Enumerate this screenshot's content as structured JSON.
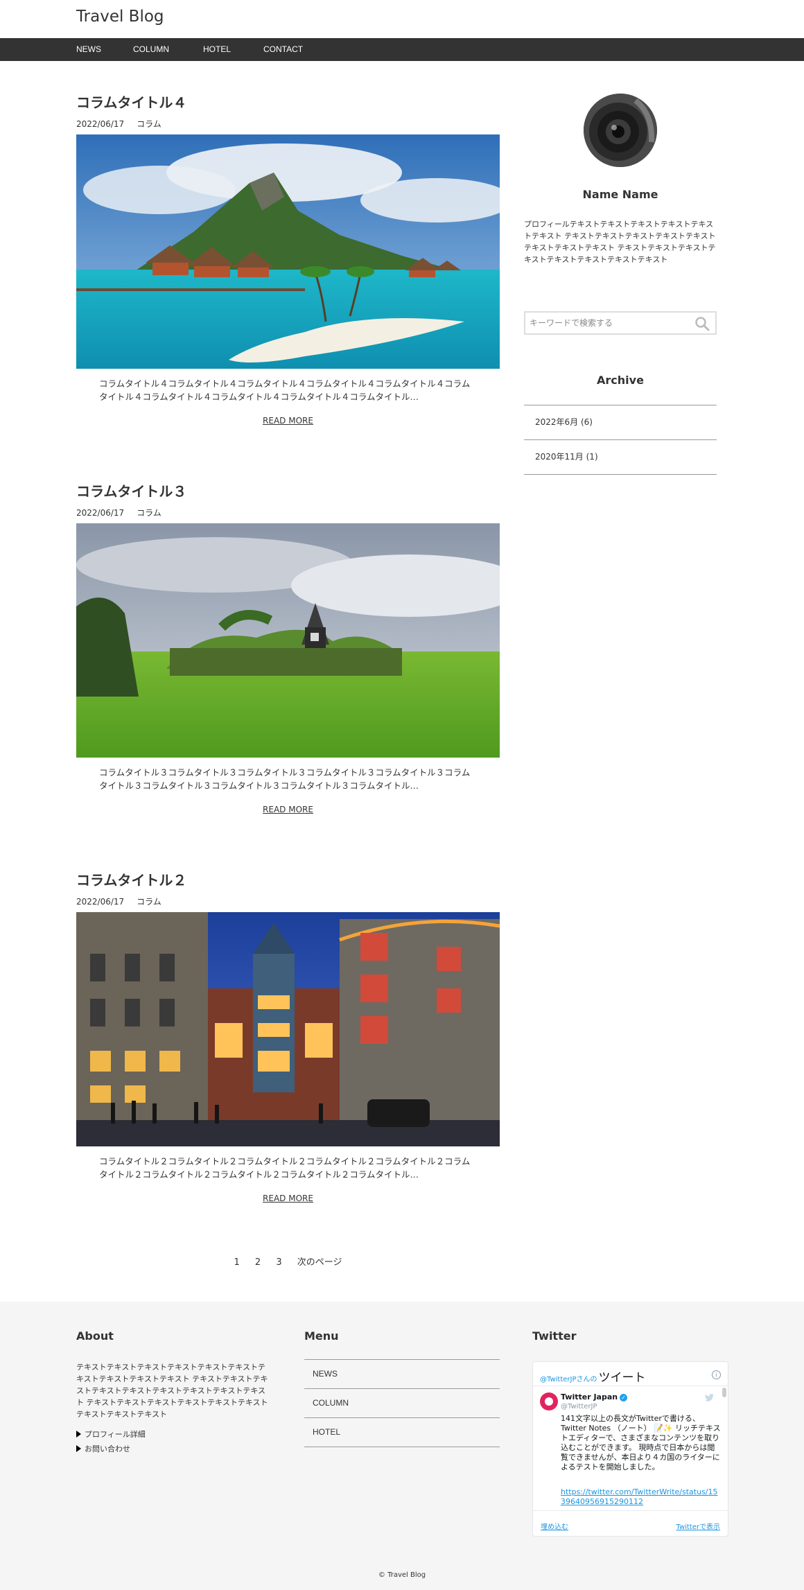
{
  "header": {
    "site_title": "Travel Blog"
  },
  "nav": {
    "items": [
      {
        "label": "NEWS"
      },
      {
        "label": "COLUMN"
      },
      {
        "label": "HOTEL"
      },
      {
        "label": "CONTACT"
      }
    ]
  },
  "posts": [
    {
      "title": "コラムタイトル４",
      "date": "2022/06/17",
      "category": "コラム",
      "excerpt": "コラムタイトル４コラムタイトル４コラムタイトル４コラムタイトル４コラムタイトル４コラムタイトル４コラムタイトル４コラムタイトル４コラムタイトル４コラムタイトル…",
      "read_more": "READ MORE"
    },
    {
      "title": "コラムタイトル３",
      "date": "2022/06/17",
      "category": "コラム",
      "excerpt": "コラムタイトル３コラムタイトル３コラムタイトル３コラムタイトル３コラムタイトル３コラムタイトル３コラムタイトル３コラムタイトル３コラムタイトル３コラムタイトル…",
      "read_more": "READ MORE"
    },
    {
      "title": "コラムタイトル２",
      "date": "2022/06/17",
      "category": "コラム",
      "excerpt": "コラムタイトル２コラムタイトル２コラムタイトル２コラムタイトル２コラムタイトル２コラムタイトル２コラムタイトル２コラムタイトル２コラムタイトル２コラムタイトル…",
      "read_more": "READ MORE"
    }
  ],
  "pagination": {
    "pages": [
      "1",
      "2",
      "3"
    ],
    "next": "次のページ"
  },
  "sidebar": {
    "profile_name": "Name Name",
    "profile_text": "プロフィールテキストテキストテキストテキストテキストテキスト テキストテキストテキストテキストテキストテキストテキストテキスト テキストテキストテキストテキストテキストテキストテキストテキスト",
    "search_placeholder": "キーワードで検索する",
    "archive_title": "Archive",
    "archives": [
      {
        "label": "2022年6月 (6)"
      },
      {
        "label": "2020年11月 (1)"
      }
    ]
  },
  "footer": {
    "about_heading": "About",
    "about_text": "テキストテキストテキストテキストテキストテキストテキストテキストテキストテキスト テキストテキストテキストテキストテキストテキストテキストテキストテキスト テキストテキストテキストテキストテキストテキストテキストテキストテキスト",
    "about_links": [
      {
        "label": "プロフィール詳細"
      },
      {
        "label": "お問い合わせ"
      }
    ],
    "menu_heading": "Menu",
    "menu_items": [
      {
        "label": "NEWS"
      },
      {
        "label": "COLUMN"
      },
      {
        "label": "HOTEL"
      }
    ],
    "twitter_heading": "Twitter",
    "copyright": "© Travel Blog"
  },
  "twitter_embed": {
    "header_prefix": "@TwitterJPさんの",
    "header_main": "ツイート",
    "info_icon": "i",
    "account_name": "Twitter Japan",
    "account_handle": "@TwitterJP",
    "tweet_text": "141文字以上の長文がTwitterで書ける、Twitter Notes （ノート） 📝✨ リッチテキストエディターで、さまざまなコンテンツを取り込むことができます。 現時点で日本からは閲覧できませんが、本日より４カ国のライターによるテストを開始しました。",
    "tweet_link": "https://twitter.com/TwitterWrite/status/1539640956915290112",
    "embed_label": "埋め込む",
    "view_label": "Twitterで表示",
    "brand_color": "#1da1f2"
  },
  "icons": {
    "search": "search-icon",
    "triangle": "triangle-right-icon",
    "twitter": "twitter-bird-icon",
    "verified": "verified-badge-icon"
  }
}
